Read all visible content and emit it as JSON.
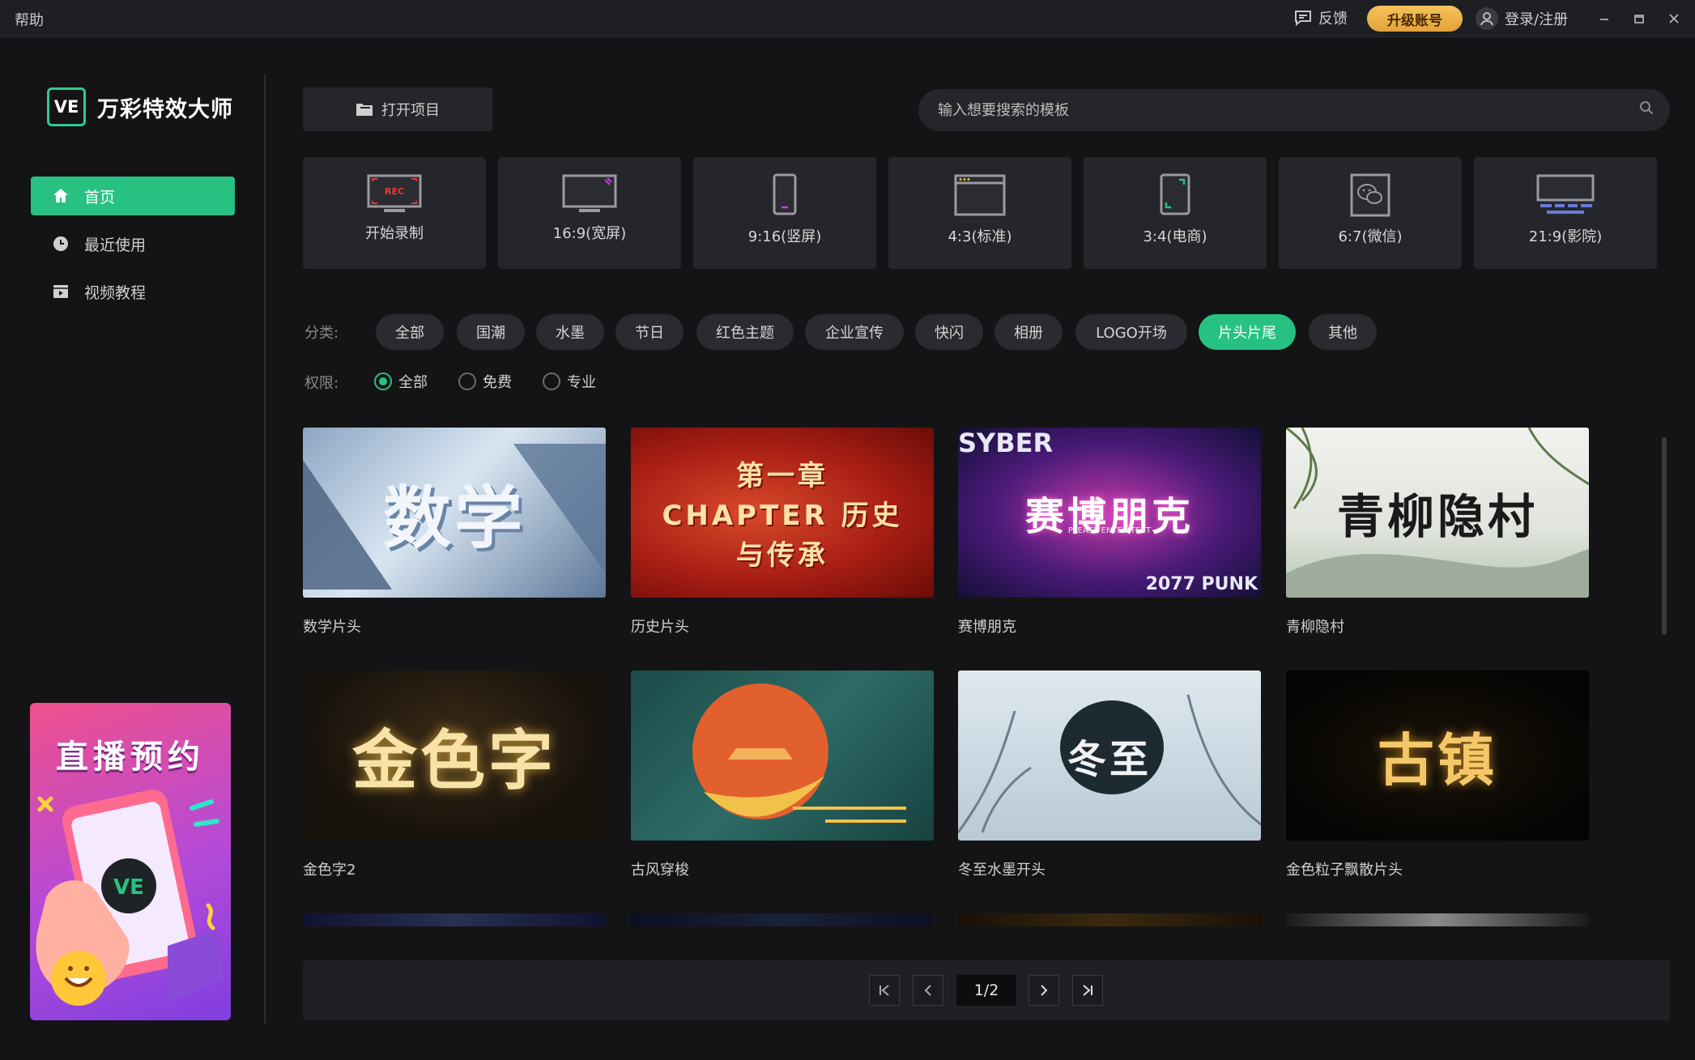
{
  "titlebar": {
    "help": "帮助",
    "feedback": "反馈",
    "upgrade": "升级账号",
    "login": "登录/注册"
  },
  "sidebar": {
    "logo_mark": "VE",
    "logo_text": "万彩特效大师",
    "items": [
      {
        "label": "首页",
        "icon": "home-icon",
        "active": true
      },
      {
        "label": "最近使用",
        "icon": "clock-icon",
        "active": false
      },
      {
        "label": "视频教程",
        "icon": "video-tutorial-icon",
        "active": false
      }
    ],
    "promo": {
      "title": "直播预约",
      "badge": "VE"
    }
  },
  "toolbar": {
    "open_project": "打开项目",
    "search_placeholder": "输入想要搜索的模板"
  },
  "ratios": [
    {
      "label": "开始录制",
      "icon": "record-screen-icon",
      "icon_text": "REC"
    },
    {
      "label": "16:9(宽屏)",
      "icon": "widescreen-icon"
    },
    {
      "label": "9:16(竖屏)",
      "icon": "portrait-phone-icon"
    },
    {
      "label": "4:3(标准)",
      "icon": "standard-window-icon"
    },
    {
      "label": "3:4(电商)",
      "icon": "ecommerce-frame-icon"
    },
    {
      "label": "6:7(微信)",
      "icon": "wechat-icon"
    },
    {
      "label": "21:9(影院)",
      "icon": "cinema-screen-icon"
    }
  ],
  "filters": {
    "category_label": "分类:",
    "categories": [
      "全部",
      "国潮",
      "水墨",
      "节日",
      "红色主题",
      "企业宣传",
      "快闪",
      "相册",
      "LOGO开场",
      "片头片尾",
      "其他"
    ],
    "active_category": "片头片尾",
    "permission_label": "权限:",
    "permissions": [
      "全部",
      "免费",
      "专业"
    ],
    "active_permission": "全部"
  },
  "templates": [
    {
      "name": "数学片头",
      "art": "数学"
    },
    {
      "name": "历史片头",
      "art": "第一章 CHAPTER 历史与传承"
    },
    {
      "name": "赛博朋克",
      "art": "赛博朋克",
      "corner_top": "SYBER",
      "corner_bottom": "2077 PUNK",
      "sub": "PLEASE ENTER TEXT"
    },
    {
      "name": "青柳隐村",
      "art": "青柳隐村"
    },
    {
      "name": "金色字2",
      "art": "金色字"
    },
    {
      "name": "古风穿梭",
      "art": ""
    },
    {
      "name": "冬至水墨开头",
      "art": "冬至"
    },
    {
      "name": "金色粒子飘散片头",
      "art": "古镇"
    }
  ],
  "pager": {
    "indicator": "1/2"
  }
}
